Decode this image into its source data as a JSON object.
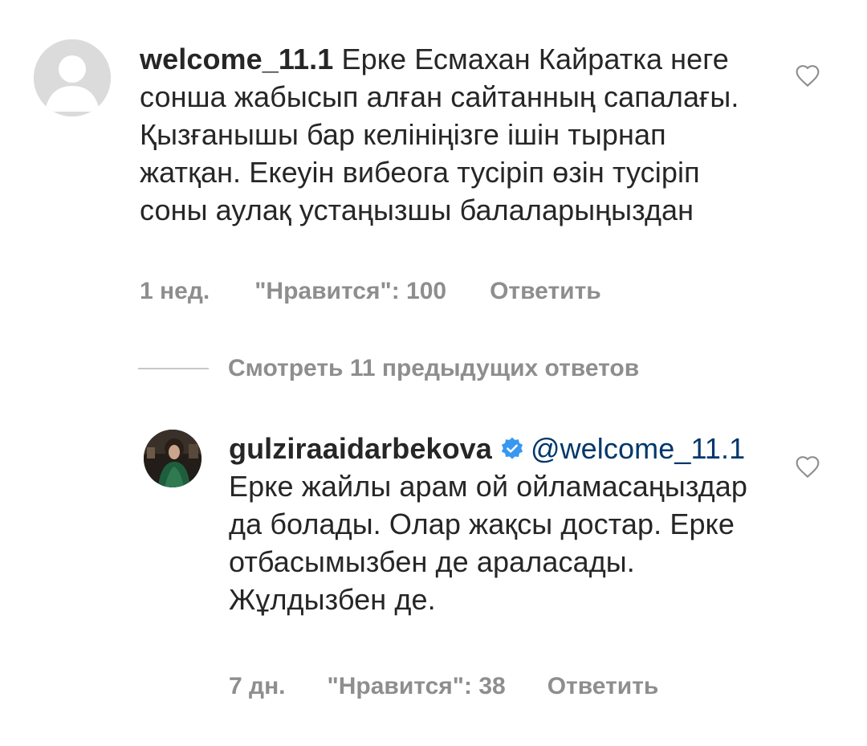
{
  "comments": [
    {
      "username": "welcome_11.1",
      "text": "Ерке Есмахан Кайратка неге сонша жабысып алған сайтанның сапалағы. Қызғанышы бар келініңізге ішін тырнап жатқан. Екеуін вибеога тусіріп өзін тусіріп соны аулақ устаңызшы балаларыңыздан",
      "time": "1 нед.",
      "likes": "\"Нравится\": 100",
      "reply_label": "Ответить",
      "like_icon": "heart-outline-icon"
    }
  ],
  "view_replies_label": "Смотреть 11 предыдущих ответов",
  "reply": {
    "username": "gulziraaidarbekova",
    "verified_icon": "verified-badge-icon",
    "verified_color": "#3897f0",
    "mention": "@welcome_11.1",
    "text": "Ерке жайлы арам ой ойламасаңыздар да болады. Олар жақсы достар. Ерке отбасымызбен де араласады. Жұлдызбен де.",
    "time": "7 дн.",
    "likes": "\"Нравится\": 38",
    "reply_label": "Ответить",
    "like_icon": "heart-outline-icon"
  },
  "colors": {
    "text": "#262626",
    "muted": "#8e8e8e",
    "mention": "#00376b",
    "default_avatar": "#dbdbdb"
  }
}
